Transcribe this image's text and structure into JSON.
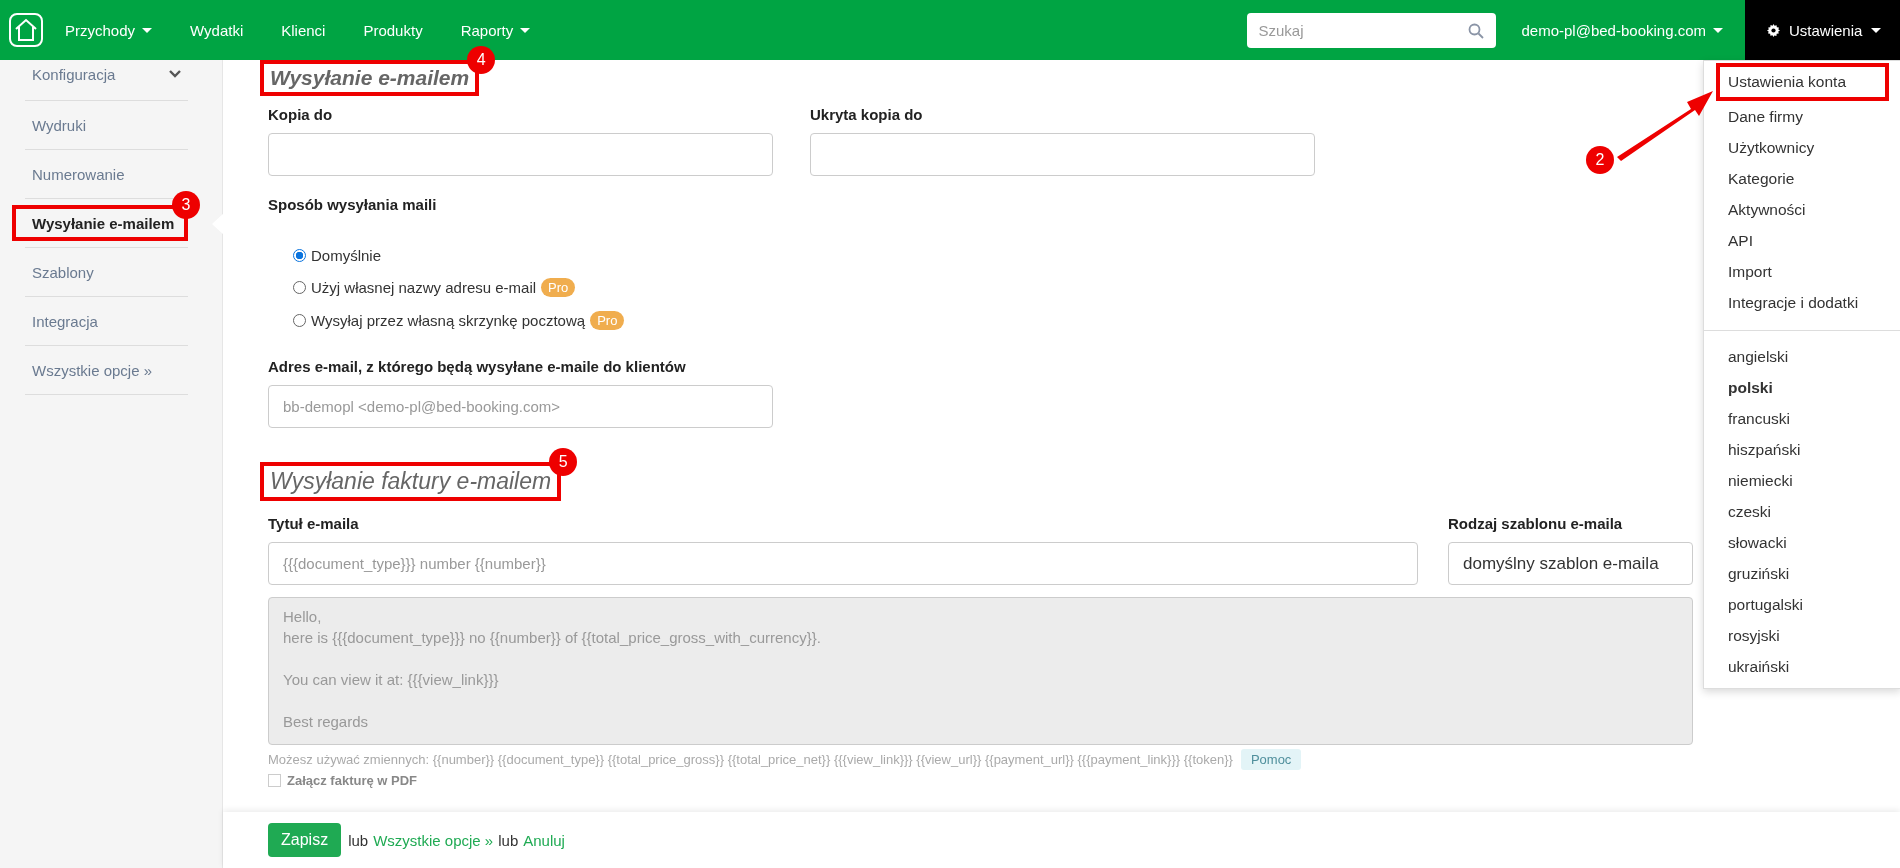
{
  "topbar": {
    "nav": [
      {
        "label": "Przychody",
        "dropdown": true
      },
      {
        "label": "Wydatki",
        "dropdown": false
      },
      {
        "label": "Klienci",
        "dropdown": false
      },
      {
        "label": "Produkty",
        "dropdown": false
      },
      {
        "label": "Raporty",
        "dropdown": true
      }
    ],
    "search": {
      "placeholder": "Szukaj"
    },
    "account": "demo-pl@bed-booking.com",
    "settings": "Ustawienia"
  },
  "sidebar": {
    "items": [
      {
        "label": "Konfiguracja",
        "kind": "header",
        "selected": false
      },
      {
        "label": "Wydruki",
        "kind": "link",
        "selected": false
      },
      {
        "label": "Numerowanie",
        "kind": "link",
        "selected": false
      },
      {
        "label": "Wysyłanie e-mailem",
        "kind": "link",
        "selected": true,
        "callout": "3"
      },
      {
        "label": "Szablony",
        "kind": "link",
        "selected": false
      },
      {
        "label": "Integracja",
        "kind": "link",
        "selected": false
      },
      {
        "label": "Wszystkie opcje »",
        "kind": "link",
        "selected": false
      }
    ]
  },
  "email_section": {
    "title": "Wysyłanie e-mailem",
    "callout": "4",
    "cc": {
      "label": "Kopia do"
    },
    "bcc": {
      "label": "Ukryta kopia do"
    },
    "method": {
      "label": "Sposób wysyłania maili",
      "options": [
        {
          "label": "Domyślnie",
          "selected": true
        },
        {
          "label": "Użyj własnej nazwy adresu e-mail",
          "selected": false,
          "badge": "Pro"
        },
        {
          "label": "Wysyłaj przez własną skrzynkę pocztową",
          "selected": false,
          "badge": "Pro"
        }
      ]
    },
    "sender": {
      "label": "Adres e-mail, z którego będą wysyłane e-maile do klientów",
      "placeholder": "bb-demopl <demo-pl@bed-booking.com>"
    }
  },
  "invoice_section": {
    "title": "Wysyłanie faktury e-mailem",
    "callout": "5",
    "subject": {
      "label": "Tytuł e-maila",
      "placeholder": "{{{document_type}}} number {{number}}"
    },
    "template": {
      "label": "Rodzaj szablonu e-maila",
      "value": "domyślny szablon e-maila"
    },
    "body": {
      "value": "Hello,\nhere is {{{document_type}}} no {{number}} of {{total_price_gross_with_currency}}.\n\nYou can view it at: {{{view_link}}}\n\nBest regards",
      "disabled": true
    },
    "hint": "Możesz używać zmiennych: {{number}} {{document_type}} {{total_price_gross}} {{total_price_net}} {{{view_link}}} {{view_url}} {{payment_url}} {{{payment_link}}} {{token}}",
    "help_button": "Pomoc",
    "attach": {
      "label": "Załącz fakturę w PDF",
      "checked": false
    }
  },
  "footer": {
    "save": "Zapisz",
    "parts": [
      {
        "kind": "text",
        "text": "lub"
      },
      {
        "kind": "link",
        "text": "Wszystkie opcje »"
      },
      {
        "kind": "text",
        "text": "lub"
      },
      {
        "kind": "link",
        "text": "Anuluj"
      }
    ]
  },
  "settings_menu": {
    "items": [
      {
        "label": "Ustawienia konta",
        "callout": "2"
      },
      {
        "label": "Dane firmy"
      },
      {
        "label": "Użytkownicy"
      },
      {
        "label": "Kategorie"
      },
      {
        "label": "Aktywności"
      },
      {
        "label": "API"
      },
      {
        "label": "Import"
      },
      {
        "label": "Integracje i dodatki"
      }
    ],
    "languages": [
      {
        "label": "angielski",
        "selected": false
      },
      {
        "label": "polski",
        "selected": true
      },
      {
        "label": "francuski",
        "selected": false
      },
      {
        "label": "hiszpański",
        "selected": false
      },
      {
        "label": "niemiecki",
        "selected": false
      },
      {
        "label": "czeski",
        "selected": false
      },
      {
        "label": "słowacki",
        "selected": false
      },
      {
        "label": "gruziński",
        "selected": false
      },
      {
        "label": "portugalski",
        "selected": false
      },
      {
        "label": "rosyjski",
        "selected": false
      },
      {
        "label": "ukraiński",
        "selected": false
      }
    ]
  }
}
